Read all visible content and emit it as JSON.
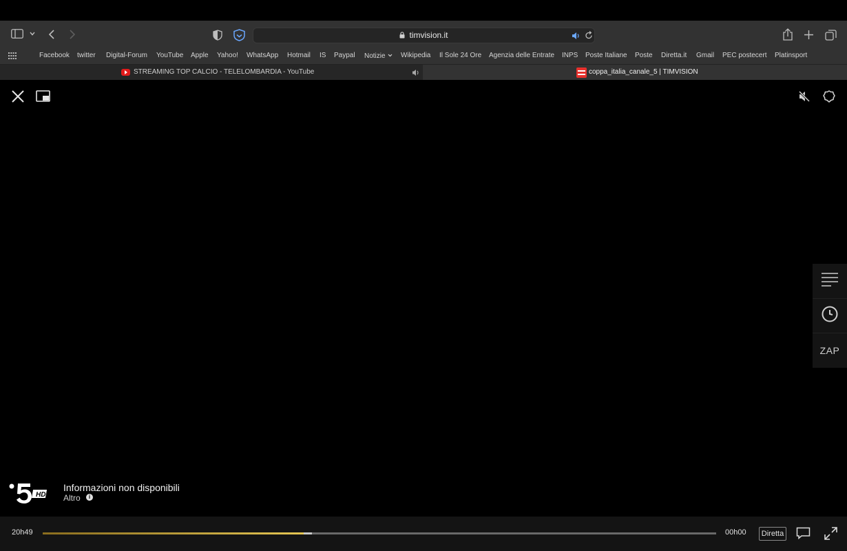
{
  "browser": {
    "address_url": "timvision.it"
  },
  "bookmarks": [
    "Facebook",
    "twitter",
    "Digital-Forum",
    "YouTube",
    "Apple",
    "Yahoo!",
    "WhatsApp",
    "Hotmail",
    "IS",
    "Paypal",
    "Notizie",
    "Wikipedia",
    "Il Sole 24 Ore",
    "Agenzia delle Entrate",
    "INPS",
    "Poste Italiane",
    "Poste",
    "Diretta.it",
    "Gmail",
    "PEC postecert",
    "Platinsport"
  ],
  "tabs": [
    {
      "title": "STREAMING TOP CALCIO - TELELOMBARDIA - YouTube",
      "favicon": "youtube-favicon"
    },
    {
      "title": "coppa_italia_canale_5 | TIMVISION",
      "favicon": "timvision-favicon"
    }
  ],
  "player": {
    "channel_logo_label": "HD",
    "program_title": "Informazioni non disponibili",
    "more_label": "Altro",
    "zap_label": "ZAP",
    "time_start": "20h49",
    "time_end": "00h00",
    "live_label": "Diretta",
    "progress_fraction": 0.388,
    "buffer_fraction": 0.4
  },
  "colors": {
    "progress_accent": "#e5c653",
    "toolbar_bg": "#323232"
  }
}
